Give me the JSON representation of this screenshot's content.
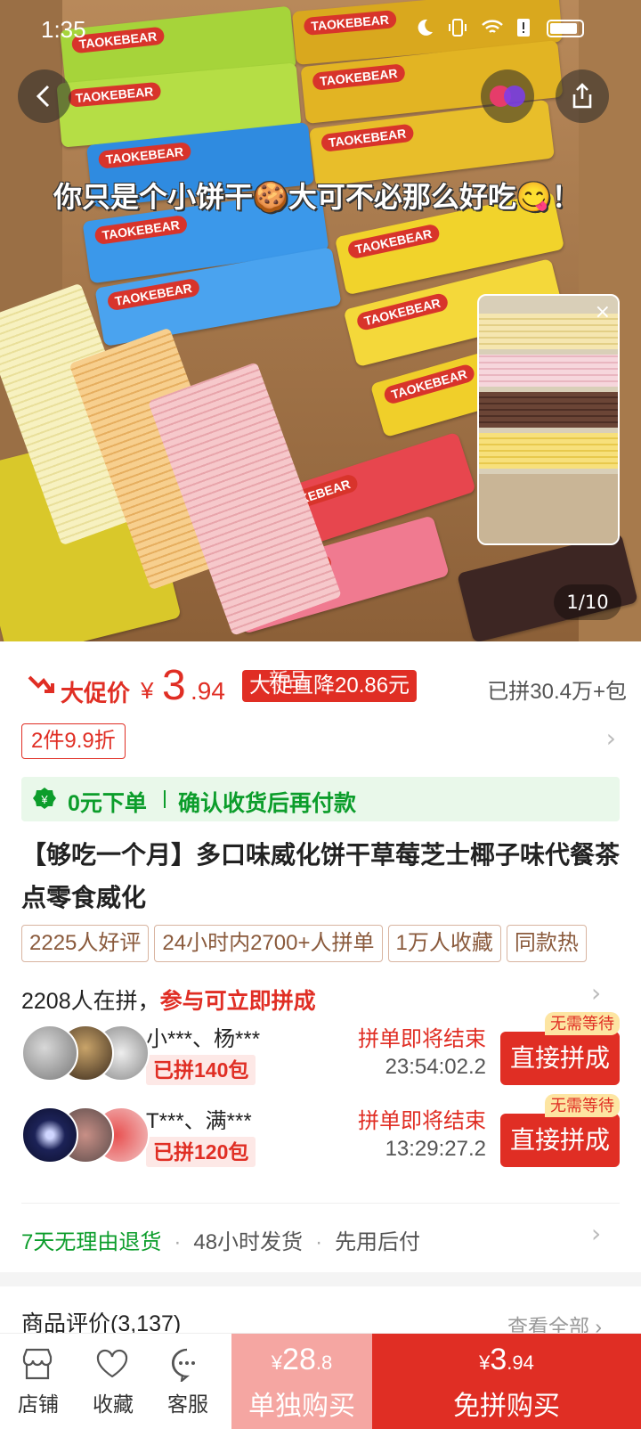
{
  "status_bar": {
    "time": "1:35"
  },
  "hero": {
    "caption": "你只是个小饼干🍪大可不必那么好吃😋！",
    "pack_brand": "TAOKEBEAR",
    "image_counter": "1/10",
    "pip_close": "×"
  },
  "price": {
    "promo_label": "大促价",
    "currency": "¥",
    "integer": "3",
    "decimal": ".94",
    "drop_tag": "大促直降20.86元",
    "drop_tag_overlap": "新品",
    "sold": "已拼30.4万+包"
  },
  "discount": {
    "tag": "2件9.9折"
  },
  "guarantee": {
    "part1": "0元下单",
    "part2": "确认收货后再付款",
    "color": "#0c9d2b"
  },
  "product": {
    "title": "【够吃一个月】多口味威化饼干草莓芝士椰子味代餐茶点零食威化"
  },
  "badges": [
    "2225人好评",
    "24小时内2700+人拼单",
    "1万人收藏",
    "同款热"
  ],
  "group": {
    "count_text": "2208人在拼，",
    "highlight": "参与可立即拼成",
    "rows": [
      {
        "names": "小***、杨***",
        "joined": "已拼140包",
        "ending": "拼单即将结束",
        "countdown": "23:54:02.2",
        "tag": "无需等待",
        "button": "直接拼成"
      },
      {
        "names": "T***、满***",
        "joined": "已拼120包",
        "ending": "拼单即将结束",
        "countdown": "13:29:27.2",
        "tag": "无需等待",
        "button": "直接拼成"
      }
    ]
  },
  "services": {
    "s1": "7天无理由退货",
    "s2": "48小时发货",
    "s3": "先用后付"
  },
  "reviews": {
    "title": "商品评价(3,137)",
    "view_all": "查看全部"
  },
  "bottom_bar": {
    "store": "店铺",
    "favorite": "收藏",
    "service": "客服",
    "solo_currency": "¥",
    "solo_int": "28",
    "solo_dec": ".8",
    "solo_label": "单独购买",
    "group_currency": "¥",
    "group_int": "3",
    "group_dec": ".94",
    "group_label": "免拼购买"
  },
  "colors": {
    "accent": "#e02e24",
    "green": "#0c9d2b",
    "solo_button": "#f5a6a2"
  }
}
